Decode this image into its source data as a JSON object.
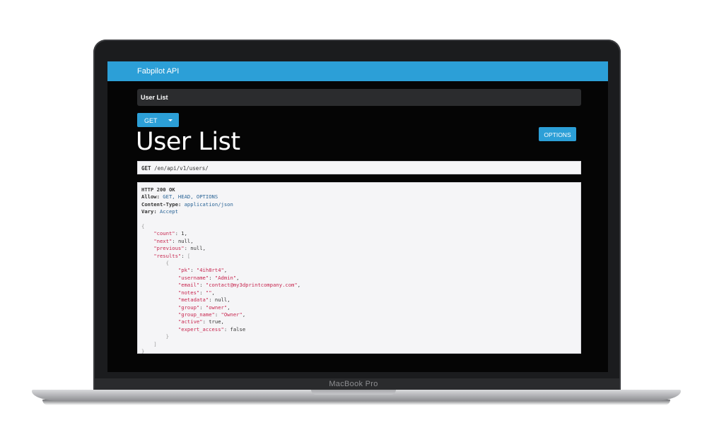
{
  "device": {
    "model_label": "MacBook Pro"
  },
  "navbar": {
    "brand": "Fabpilot API"
  },
  "breadcrumb": {
    "current": "User List"
  },
  "toolbar": {
    "get_label": "GET",
    "options_label": "OPTIONS"
  },
  "page": {
    "title": "User List"
  },
  "request": {
    "method": "GET",
    "path": "/en/api/v1/users/"
  },
  "response": {
    "status_line": "HTTP 200 OK",
    "headers": [
      {
        "name": "Allow",
        "value": "GET, HEAD, OPTIONS"
      },
      {
        "name": "Content-Type",
        "value": "application/json"
      },
      {
        "name": "Vary",
        "value": "Accept"
      }
    ],
    "body": {
      "count": "1",
      "next": "null",
      "previous": "null",
      "result": {
        "pk": "\"4ih8rt4\"",
        "username": "\"Admin\"",
        "email": "\"contact@my3dprintcompany.com\"",
        "notes": "\"\"",
        "metadata": "null",
        "group": "\"owner\"",
        "group_name": "\"Owner\"",
        "active": "true",
        "expert_access": "false"
      }
    }
  },
  "colors": {
    "navbar": "#2c9fd7",
    "button": "#2c9fd7",
    "screen_bg": "#050505",
    "json_key": "#c7254e",
    "header_value": "#2a6496"
  }
}
